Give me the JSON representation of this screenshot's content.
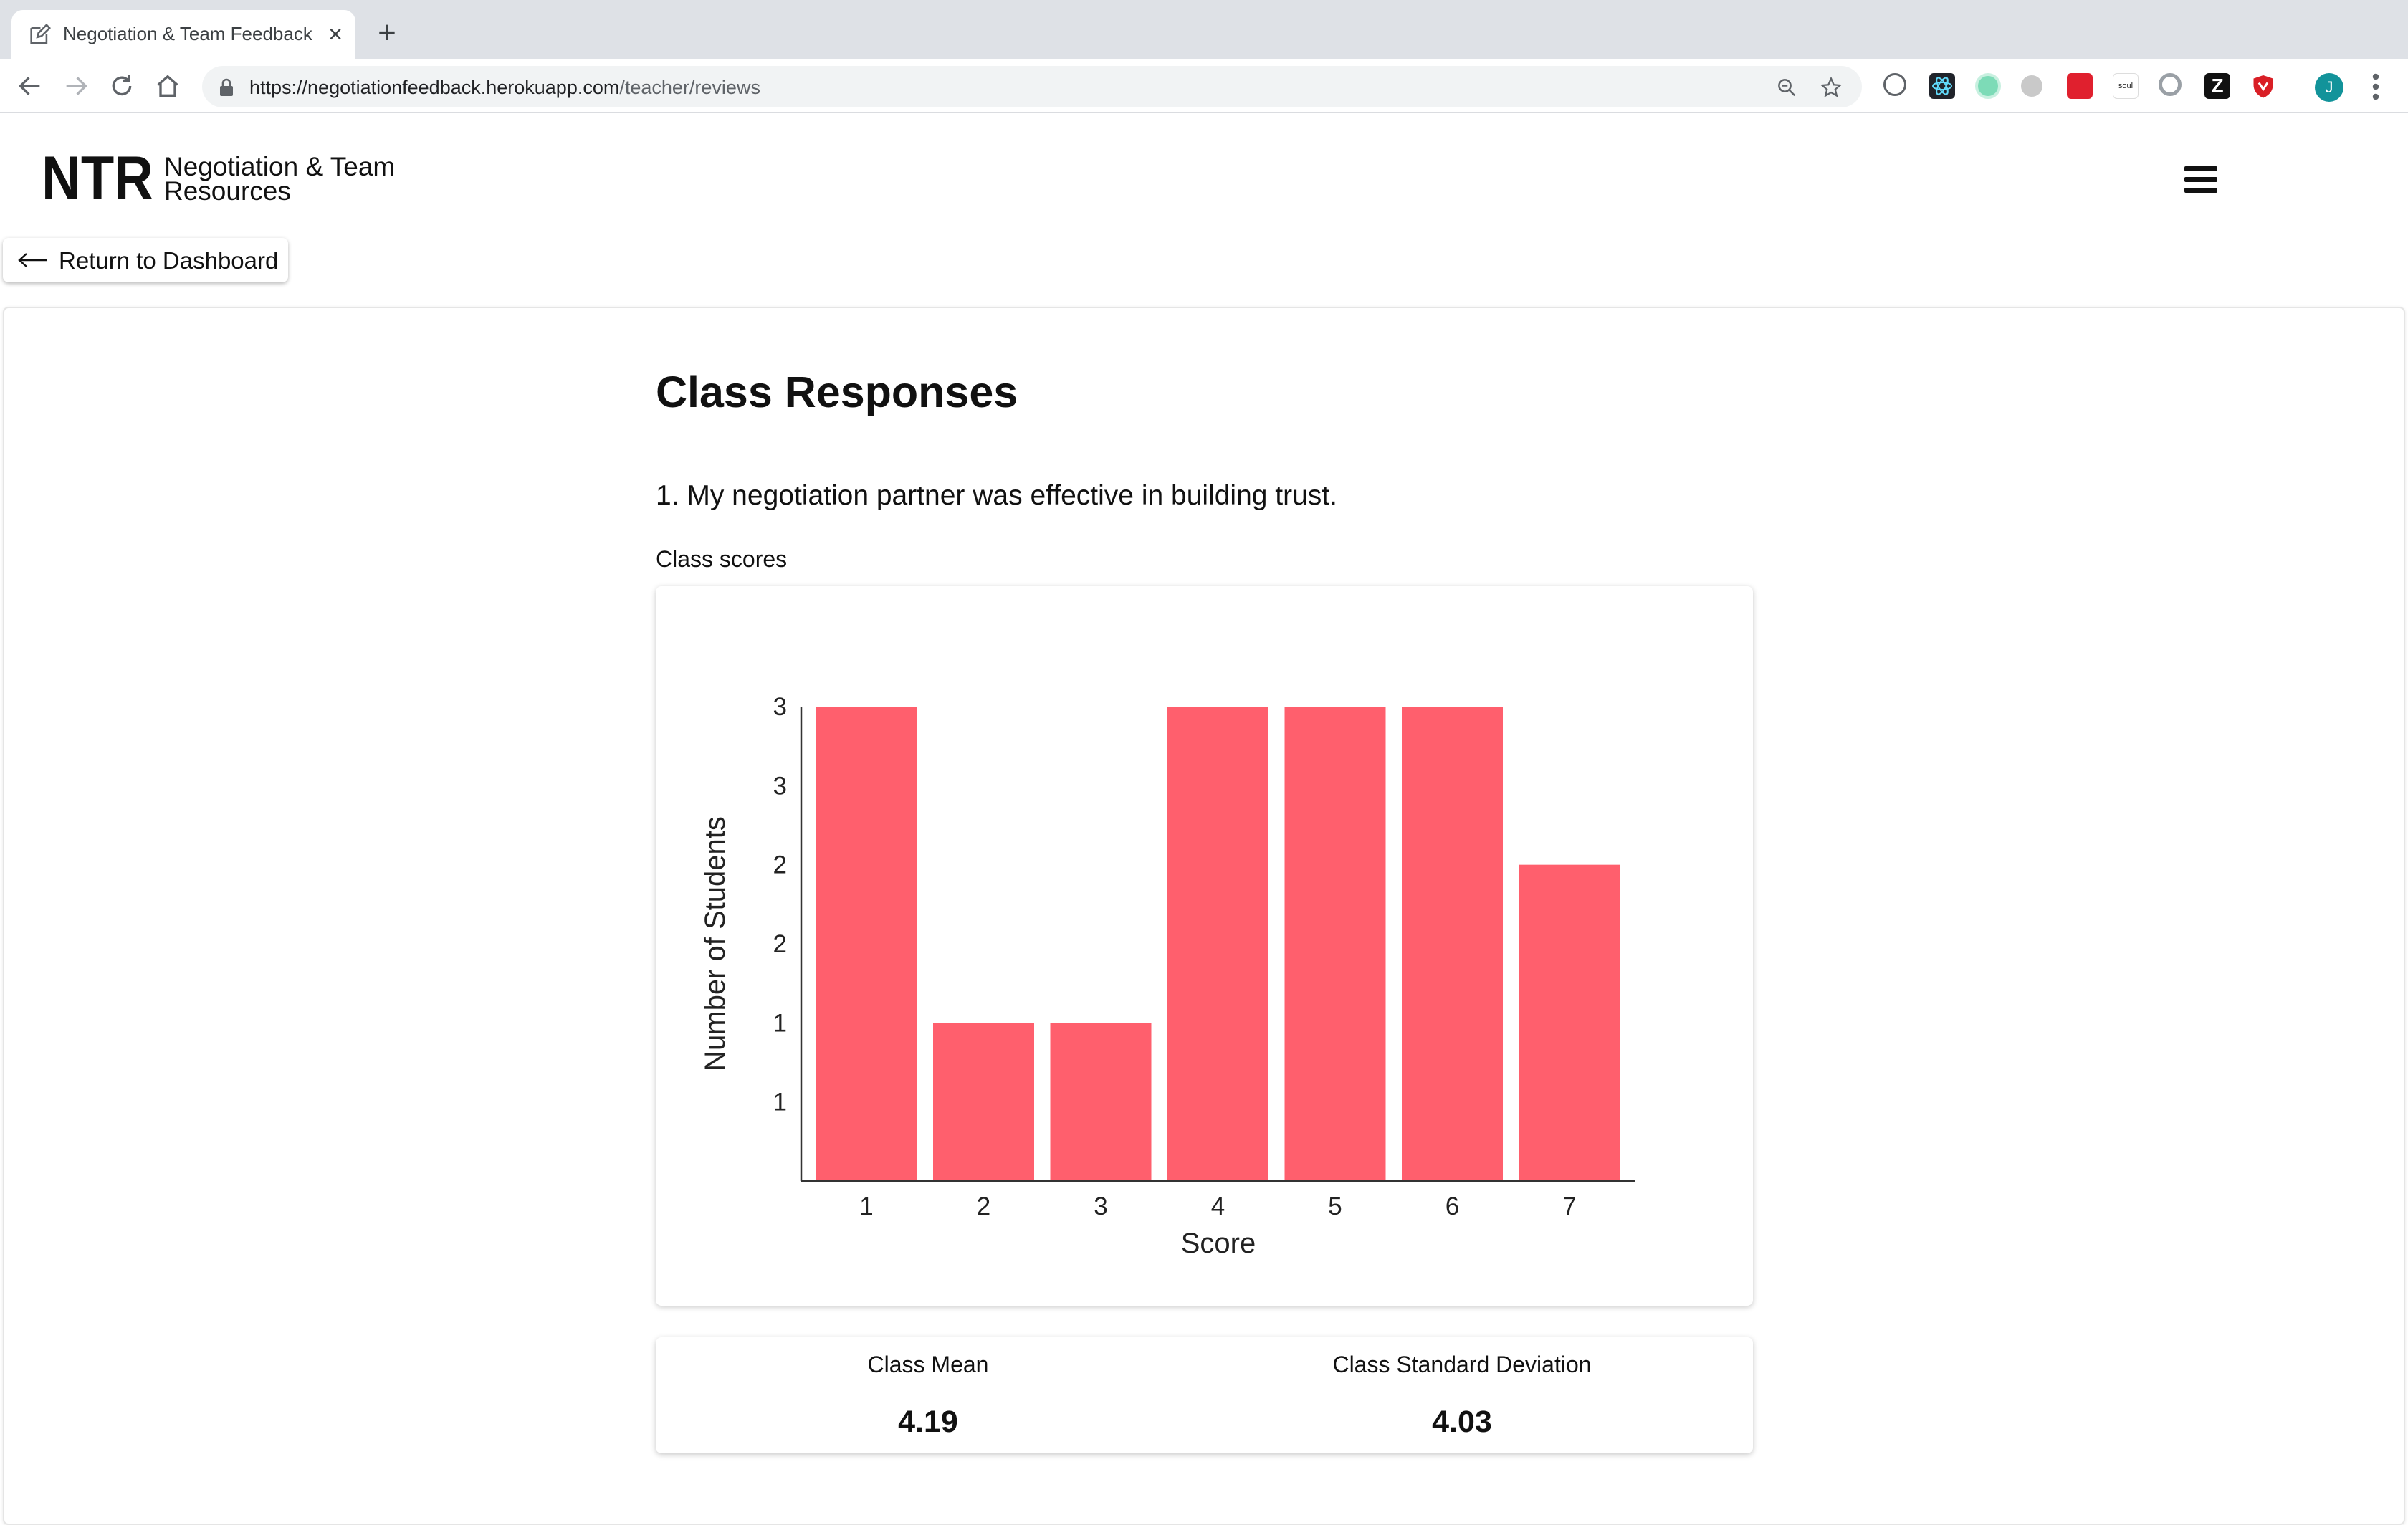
{
  "browser": {
    "tab_title": "Negotiation & Team Feedback",
    "url_host": "https://negotiationfeedback.herokuapp.com",
    "url_path": "/teacher/reviews",
    "profile_initial": "J"
  },
  "header": {
    "logo_text": "NTR",
    "brand_line_1": "Negotiation & Team",
    "brand_line_2": "Resources"
  },
  "nav": {
    "back_label": "Return to Dashboard"
  },
  "main": {
    "title": "Class Responses",
    "question": "1. My negotiation partner was effective in building trust.",
    "section_label": "Class scores"
  },
  "stats": {
    "mean_label": "Class Mean",
    "mean_value": "4.19",
    "sd_label": "Class Standard Deviation",
    "sd_value": "4.03"
  },
  "colors": {
    "bar": "#ff5f6d",
    "axis": "#333333"
  },
  "chart_data": {
    "type": "bar",
    "categories": [
      "1",
      "2",
      "3",
      "4",
      "5",
      "6",
      "7"
    ],
    "values": [
      3,
      1,
      1,
      3,
      3,
      3,
      2
    ],
    "xlabel": "Score",
    "ylabel": "Number of Students",
    "ylim": [
      0,
      3
    ],
    "y_tick_values": [
      0.5,
      1,
      1.5,
      2,
      2.5,
      3
    ],
    "y_tick_labels": [
      "1",
      "1",
      "2",
      "2",
      "3",
      "3"
    ],
    "grid": false,
    "legend": "none"
  }
}
